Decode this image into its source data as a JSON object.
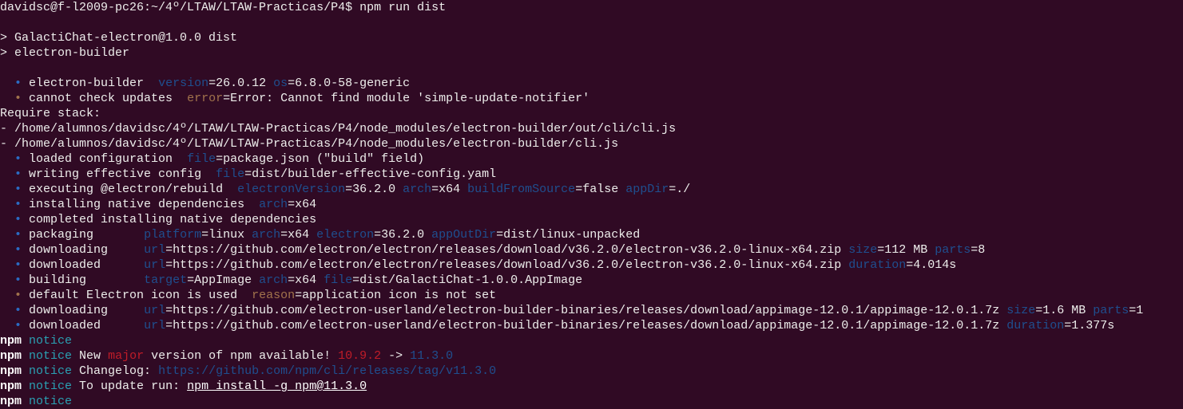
{
  "terminal": {
    "background": "#300a24",
    "lines": [
      [
        [
          "w",
          "davidsc@f-l2009-pc26:~/4º/LTAW/LTAW-Practicas/P4$ npm run dist"
        ]
      ],
      [],
      [
        [
          "w",
          "> GalactiChat-electron@1.0.0 dist"
        ]
      ],
      [
        [
          "w",
          "> electron-builder"
        ]
      ],
      [],
      [
        [
          "w",
          "  "
        ],
        [
          "b",
          "•"
        ],
        [
          "w",
          " electron-builder  "
        ],
        [
          "k",
          "version"
        ],
        [
          "w",
          "=26.0.12 "
        ],
        [
          "k",
          "os"
        ],
        [
          "w",
          "=6.8.0-58-generic"
        ]
      ],
      [
        [
          "w",
          "  "
        ],
        [
          "o",
          "•"
        ],
        [
          "w",
          " cannot check updates  "
        ],
        [
          "o",
          "error"
        ],
        [
          "w",
          "=Error: Cannot find module 'simple-update-notifier'"
        ]
      ],
      [
        [
          "w",
          "Require stack:"
        ]
      ],
      [
        [
          "w",
          "- /home/alumnos/davidsc/4º/LTAW/LTAW-Practicas/P4/node_modules/electron-builder/out/cli/cli.js"
        ]
      ],
      [
        [
          "w",
          "- /home/alumnos/davidsc/4º/LTAW/LTAW-Practicas/P4/node_modules/electron-builder/cli.js"
        ]
      ],
      [
        [
          "w",
          "  "
        ],
        [
          "b",
          "•"
        ],
        [
          "w",
          " loaded configuration  "
        ],
        [
          "k",
          "file"
        ],
        [
          "w",
          "=package.json (\"build\" field)"
        ]
      ],
      [
        [
          "w",
          "  "
        ],
        [
          "b",
          "•"
        ],
        [
          "w",
          " writing effective config  "
        ],
        [
          "k",
          "file"
        ],
        [
          "w",
          "=dist/builder-effective-config.yaml"
        ]
      ],
      [
        [
          "w",
          "  "
        ],
        [
          "b",
          "•"
        ],
        [
          "w",
          " executing @electron/rebuild  "
        ],
        [
          "k",
          "electronVersion"
        ],
        [
          "w",
          "=36.2.0 "
        ],
        [
          "k",
          "arch"
        ],
        [
          "w",
          "=x64 "
        ],
        [
          "k",
          "buildFromSource"
        ],
        [
          "w",
          "=false "
        ],
        [
          "k",
          "appDir"
        ],
        [
          "w",
          "=./"
        ]
      ],
      [
        [
          "w",
          "  "
        ],
        [
          "b",
          "•"
        ],
        [
          "w",
          " installing native dependencies  "
        ],
        [
          "k",
          "arch"
        ],
        [
          "w",
          "=x64"
        ]
      ],
      [
        [
          "w",
          "  "
        ],
        [
          "b",
          "•"
        ],
        [
          "w",
          " completed installing native dependencies"
        ]
      ],
      [
        [
          "w",
          "  "
        ],
        [
          "b",
          "•"
        ],
        [
          "w",
          " packaging       "
        ],
        [
          "k",
          "platform"
        ],
        [
          "w",
          "=linux "
        ],
        [
          "k",
          "arch"
        ],
        [
          "w",
          "=x64 "
        ],
        [
          "k",
          "electron"
        ],
        [
          "w",
          "=36.2.0 "
        ],
        [
          "k",
          "appOutDir"
        ],
        [
          "w",
          "=dist/linux-unpacked"
        ]
      ],
      [
        [
          "w",
          "  "
        ],
        [
          "b",
          "•"
        ],
        [
          "w",
          " downloading     "
        ],
        [
          "k",
          "url"
        ],
        [
          "w",
          "=https://github.com/electron/electron/releases/download/v36.2.0/electron-v36.2.0-linux-x64.zip "
        ],
        [
          "k",
          "size"
        ],
        [
          "w",
          "=112 MB "
        ],
        [
          "k",
          "parts"
        ],
        [
          "w",
          "=8"
        ]
      ],
      [
        [
          "w",
          "  "
        ],
        [
          "b",
          "•"
        ],
        [
          "w",
          " downloaded      "
        ],
        [
          "k",
          "url"
        ],
        [
          "w",
          "=https://github.com/electron/electron/releases/download/v36.2.0/electron-v36.2.0-linux-x64.zip "
        ],
        [
          "k",
          "duration"
        ],
        [
          "w",
          "=4.014s"
        ]
      ],
      [
        [
          "w",
          "  "
        ],
        [
          "b",
          "•"
        ],
        [
          "w",
          " building        "
        ],
        [
          "k",
          "target"
        ],
        [
          "w",
          "=AppImage "
        ],
        [
          "k",
          "arch"
        ],
        [
          "w",
          "=x64 "
        ],
        [
          "k",
          "file"
        ],
        [
          "w",
          "=dist/GalactiChat-1.0.0.AppImage"
        ]
      ],
      [
        [
          "w",
          "  "
        ],
        [
          "o",
          "•"
        ],
        [
          "w",
          " default Electron icon is used  "
        ],
        [
          "o",
          "reason"
        ],
        [
          "w",
          "=application icon is not set"
        ]
      ],
      [
        [
          "w",
          "  "
        ],
        [
          "b",
          "•"
        ],
        [
          "w",
          " downloading     "
        ],
        [
          "k",
          "url"
        ],
        [
          "w",
          "=https://github.com/electron-userland/electron-builder-binaries/releases/download/appimage-12.0.1/appimage-12.0.1.7z "
        ],
        [
          "k",
          "size"
        ],
        [
          "w",
          "=1.6 MB "
        ],
        [
          "k",
          "parts"
        ],
        [
          "w",
          "=1"
        ]
      ],
      [
        [
          "w",
          "  "
        ],
        [
          "b",
          "•"
        ],
        [
          "w",
          " downloaded      "
        ],
        [
          "k",
          "url"
        ],
        [
          "w",
          "=https://github.com/electron-userland/electron-builder-binaries/releases/download/appimage-12.0.1/appimage-12.0.1.7z "
        ],
        [
          "k",
          "duration"
        ],
        [
          "w",
          "=1.377s"
        ]
      ],
      [
        [
          "n",
          "npm"
        ],
        [
          "w",
          " "
        ],
        [
          "c",
          "notice"
        ]
      ],
      [
        [
          "n",
          "npm"
        ],
        [
          "w",
          " "
        ],
        [
          "c",
          "notice"
        ],
        [
          "w",
          " New "
        ],
        [
          "r",
          "major"
        ],
        [
          "w",
          " version of npm available! "
        ],
        [
          "r",
          "10.9.2"
        ],
        [
          "w",
          " -> "
        ],
        [
          "v",
          "11.3.0"
        ]
      ],
      [
        [
          "n",
          "npm"
        ],
        [
          "w",
          " "
        ],
        [
          "c",
          "notice"
        ],
        [
          "w",
          " Changelog: "
        ],
        [
          "v",
          "https://github.com/npm/cli/releases/tag/v11.3.0"
        ]
      ],
      [
        [
          "n",
          "npm"
        ],
        [
          "w",
          " "
        ],
        [
          "c",
          "notice"
        ],
        [
          "w",
          " To update run: "
        ],
        [
          "u",
          "npm install -g npm@11.3.0"
        ]
      ],
      [
        [
          "n",
          "npm"
        ],
        [
          "w",
          " "
        ],
        [
          "c",
          "notice"
        ]
      ]
    ]
  }
}
